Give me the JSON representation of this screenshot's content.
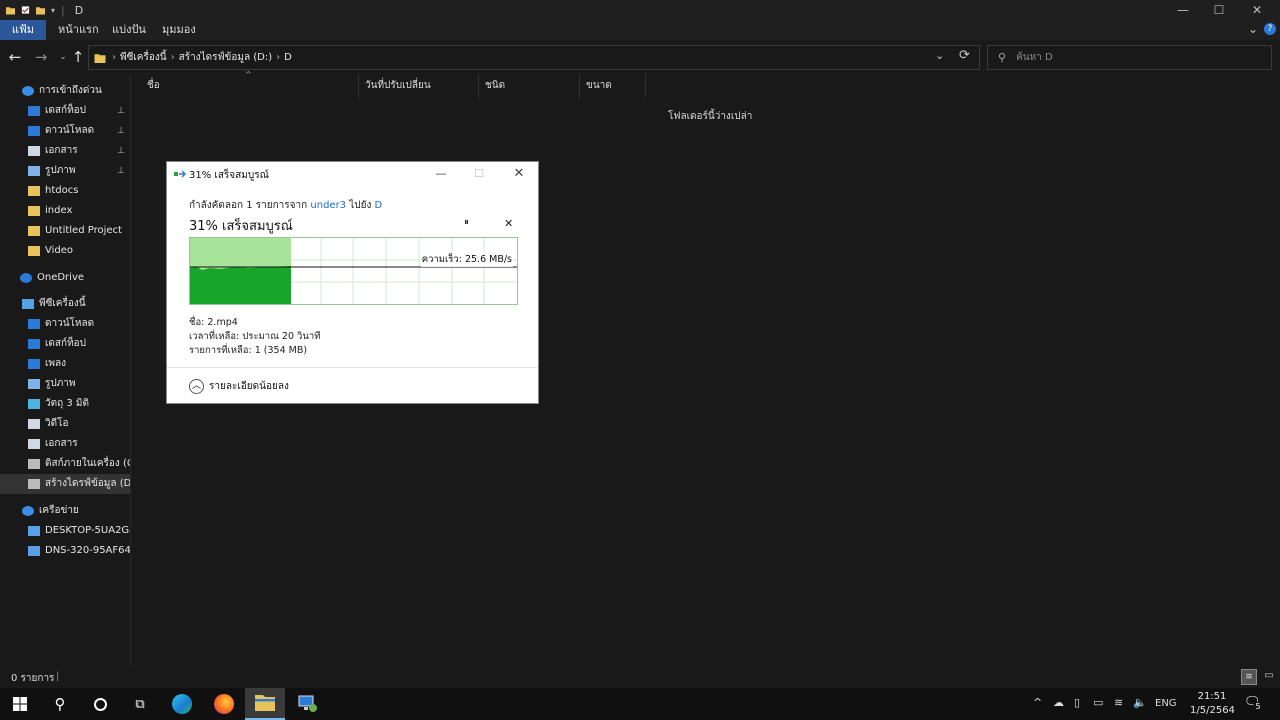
{
  "window": {
    "title": "D",
    "minimize": "—",
    "maximize": "☐",
    "close": "✕"
  },
  "ribbon": {
    "tabs": [
      "แฟ้ม",
      "หน้าแรก",
      "แบ่งปัน",
      "มุมมอง"
    ]
  },
  "address": {
    "breadcrumbs": [
      "พีซีเครื่องนี้",
      "สร้างไดรฟ์ข้อมูล (D:)",
      "D"
    ],
    "separator": "›"
  },
  "search": {
    "placeholder": "ค้นหา D"
  },
  "columns": [
    "ชื่อ",
    "วันที่ปรับเปลี่ยน",
    "ชนิด",
    "ขนาด"
  ],
  "main": {
    "empty_text": "โฟลเดอร์นี้ว่างเปล่า"
  },
  "sidebar": {
    "items": [
      {
        "label": "การเข้าถึงด่วน",
        "icon": "star-icon",
        "pinned": false
      },
      {
        "label": "เดสก์ท็อป",
        "icon": "desktop-icon",
        "pinned": true
      },
      {
        "label": "ดาวน์โหลด",
        "icon": "download-icon",
        "pinned": true
      },
      {
        "label": "เอกสาร",
        "icon": "document-icon",
        "pinned": true
      },
      {
        "label": "รูปภาพ",
        "icon": "pictures-icon",
        "pinned": true
      },
      {
        "label": "htdocs",
        "icon": "folder-icon",
        "pinned": false
      },
      {
        "label": "index",
        "icon": "folder-icon",
        "pinned": false
      },
      {
        "label": "Untitled Project",
        "icon": "folder-icon",
        "pinned": false
      },
      {
        "label": "Video",
        "icon": "folder-icon",
        "pinned": false
      },
      {
        "label": "OneDrive",
        "icon": "cloud-icon",
        "pinned": false
      },
      {
        "label": "พีซีเครื่องนี้",
        "icon": "computer-icon",
        "pinned": false
      },
      {
        "label": "ดาวน์โหลด",
        "icon": "download-icon",
        "pinned": false
      },
      {
        "label": "เดสก์ท็อป",
        "icon": "desktop-icon",
        "pinned": false
      },
      {
        "label": "เพลง",
        "icon": "music-icon",
        "pinned": false
      },
      {
        "label": "รูปภาพ",
        "icon": "pictures-icon",
        "pinned": false
      },
      {
        "label": "วัตถุ 3 มิติ",
        "icon": "cube-icon",
        "pinned": false
      },
      {
        "label": "วิดีโอ",
        "icon": "video-icon",
        "pinned": false
      },
      {
        "label": "เอกสาร",
        "icon": "document-icon",
        "pinned": false
      },
      {
        "label": "ดิสก์ภายในเครื่อง (C:)",
        "icon": "drive-icon",
        "pinned": false
      },
      {
        "label": "สร้างไดรฟ์ข้อมูล (D:)",
        "icon": "drive-icon",
        "pinned": false
      },
      {
        "label": "เครือข่าย",
        "icon": "network-icon",
        "pinned": false
      },
      {
        "label": "DESKTOP-5UA2G81",
        "icon": "computer-icon",
        "pinned": false
      },
      {
        "label": "DNS-320-95AF64",
        "icon": "computer-icon",
        "pinned": false
      }
    ],
    "pin_glyph": "📌"
  },
  "status": {
    "items": "0 รายการ",
    "divider": "|"
  },
  "dialog": {
    "title": "31% เสร็จสมบูรณ์",
    "copy_prefix": "กำลังคัดลอก 1 รายการจาก",
    "source": "under3",
    "copy_mid": "ไปยัง",
    "destination": "D",
    "percent_text": "31% เสร็จสมบูรณ์",
    "progress": 0.31,
    "speed": "ความเร็ว: 25.6 MB/s",
    "name": "ชื่อ:  2.mp4",
    "time_left": "เวลาที่เหลือ:  ประมาณ 20 วินาที",
    "items_left": "รายการที่เหลือ:  1 (354 MB)",
    "more_details": "รายละเอียดน้อยลง",
    "pause_glyph": "⏸",
    "cancel_glyph": "✕"
  },
  "taskbar": {
    "time": "21:51",
    "date": "1/5/2564",
    "lang": "ENG",
    "notifications": "5"
  },
  "colors": {
    "accent": "#2b579a",
    "progress_green": "#17a62b",
    "progress_light": "#a8e39a"
  }
}
